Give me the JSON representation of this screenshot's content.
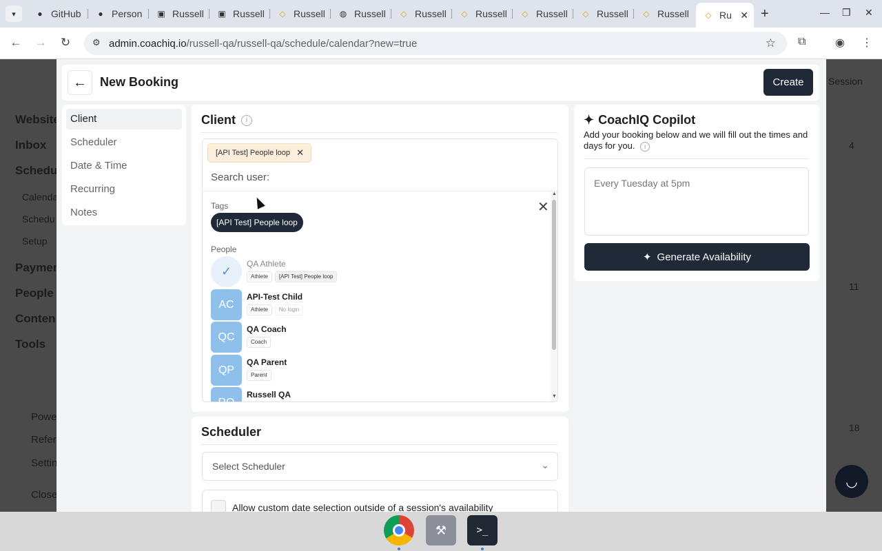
{
  "browser": {
    "tabs": [
      {
        "label": "GitHub",
        "icon": "github-icon"
      },
      {
        "label": "Person",
        "icon": "github-icon"
      },
      {
        "label": "Russell",
        "icon": "folder-icon"
      },
      {
        "label": "Russell",
        "icon": "folder-icon"
      },
      {
        "label": "Russell",
        "icon": "coachiq-icon"
      },
      {
        "label": "Russell",
        "icon": "globe-icon"
      },
      {
        "label": "Russell",
        "icon": "coachiq-icon"
      },
      {
        "label": "Russell",
        "icon": "coachiq-icon"
      },
      {
        "label": "Russell",
        "icon": "coachiq-icon"
      },
      {
        "label": "Russell",
        "icon": "coachiq-icon"
      },
      {
        "label": "Russell",
        "icon": "coachiq-icon"
      },
      {
        "label": "Ru",
        "icon": "coachiq-icon",
        "active": true
      }
    ],
    "url_host": "admin.coachiq.io",
    "url_path": "/russell-qa/russell-qa/schedule/calendar?new=true"
  },
  "background_page": {
    "nav_items": [
      "Website",
      "Inbox",
      "Schedul",
      "Calenda",
      "Schedu",
      "Setup",
      "Paymen",
      "People",
      "Conten",
      "Tools"
    ],
    "footer_items": [
      "Powe",
      "Refer",
      "Settin",
      "Close"
    ],
    "header_button": "Session",
    "calendar_numbers": [
      "4",
      "11",
      "18"
    ]
  },
  "modal": {
    "back_icon": "arrow-left-icon",
    "title": "New Booking",
    "create_label": "Create",
    "sidenav": [
      "Client",
      "Scheduler",
      "Date & Time",
      "Recurring",
      "Notes"
    ],
    "client": {
      "title": "Client",
      "selected_chip": "[API Test] People loop",
      "search_placeholder": "Search user:",
      "tags_label": "Tags",
      "tags": [
        "[API Test] People loop"
      ],
      "people_label": "People",
      "people": [
        {
          "name": "QA Athlete",
          "initials": "",
          "selected": true,
          "badges": [
            "Athlete",
            "[API Test] People loop"
          ]
        },
        {
          "name": "API-Test Child",
          "initials": "AC",
          "selected": false,
          "badges": [
            "Athlete",
            "No login"
          ]
        },
        {
          "name": "QA Coach",
          "initials": "QC",
          "selected": false,
          "badges": [
            "Coach"
          ]
        },
        {
          "name": "QA Parent",
          "initials": "QP",
          "selected": false,
          "badges": [
            "Parent"
          ]
        },
        {
          "name": "Russell QA",
          "initials": "RQ",
          "selected": false,
          "badges": []
        }
      ]
    },
    "scheduler": {
      "title": "Scheduler",
      "select_placeholder": "Select Scheduler",
      "custom_date_label": "Allow custom date selection outside of a session's availability"
    },
    "copilot": {
      "title": "CoachIQ Copilot",
      "description": "Add your booking below and we will fill out the times and days for you.",
      "prompt_placeholder": "Every Tuesday at 5pm",
      "generate_label": "Generate Availability"
    }
  },
  "colors": {
    "primary_dark": "#1f2937",
    "avatar_blue": "#8fc0ec",
    "chip_bg": "#fbefdc",
    "overlay": "#4a4a4a"
  }
}
